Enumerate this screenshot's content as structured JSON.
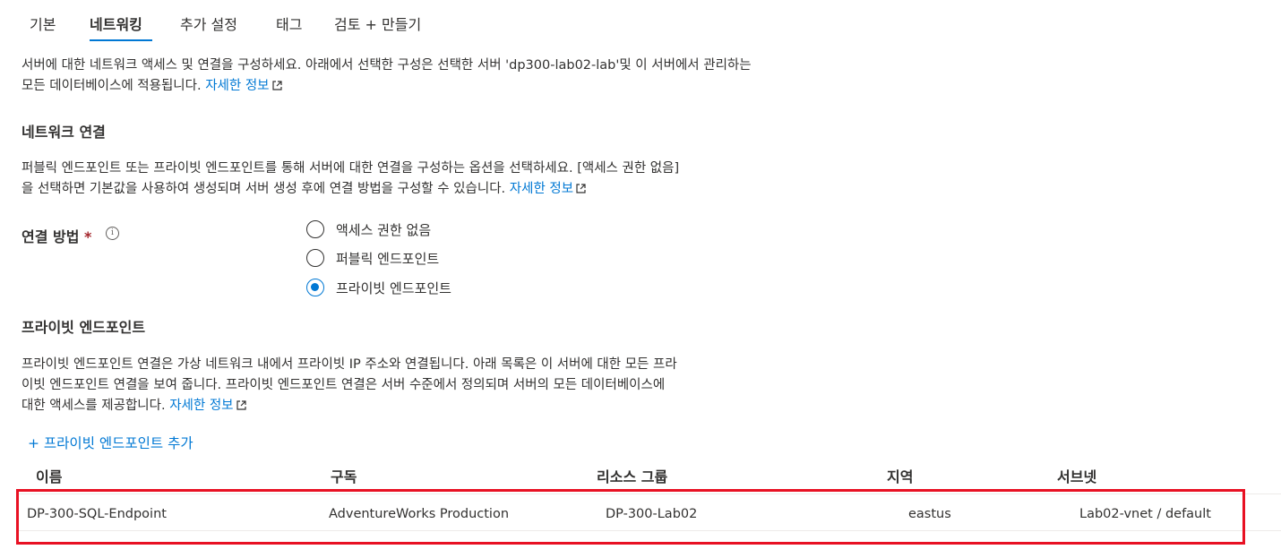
{
  "tabs": [
    "기본",
    "네트워킹",
    "추가 설정",
    "태그",
    "검토 + 만들기"
  ],
  "intro": {
    "line1": "서버에 대한 네트워크 액세스 및 연결을 구성하세요. 아래에서 선택한 구성은 선택한 서버 'dp300-lab02-lab'및 이 서버에서 관리하는",
    "line2": "모든 데이터베이스에 적용됩니다.",
    "link": "자세한 정보"
  },
  "network": {
    "heading": "네트워크 연결",
    "line1": "퍼블릭 엔드포인트 또는 프라이빗 엔드포인트를 통해 서버에 대한 연결을 구성하는 옵션을 선택하세요. [액세스 권한 없음]",
    "line2": "을 선택하면 기본값을 사용하여 생성되며 서버 생성 후에 연결 방법을 구성할 수 있습니다.",
    "link": "자세한 정보"
  },
  "method": {
    "label": "연결 방법",
    "required": "*",
    "info": "i",
    "options": [
      "액세스 권한 없음",
      "퍼블릭 엔드포인트",
      "프라이빗 엔드포인트"
    ],
    "selected": "프라이빗 엔드포인트"
  },
  "private": {
    "heading": "프라이빗 엔드포인트",
    "line1": "프라이빗 엔드포인트 연결은 가상 네트워크 내에서 프라이빗 IP 주소와 연결됩니다. 아래 목록은 이 서버에 대한 모든 프라",
    "line2": "이빗 엔드포인트 연결을 보여 줍니다. 프라이빗 엔드포인트 연결은 서버 수준에서 정의되며 서버의 모든 데이터베이스에",
    "line3": "대한 액세스를 제공합니다.",
    "link": "자세한 정보",
    "add": "+ 프라이빗 엔드포인트 추가"
  },
  "table": {
    "columns": [
      "이름",
      "구독",
      "리소스 그룹",
      "지역",
      "서브넷"
    ],
    "rows": [
      [
        "DP-300-SQL-Endpoint",
        "AdventureWorks Production",
        "DP-300-Lab02",
        "eastus",
        "Lab02-vnet / default"
      ]
    ]
  },
  "colors": {
    "accent": "#0078d4",
    "highlight": "#e81123",
    "required": "#a4262c"
  }
}
